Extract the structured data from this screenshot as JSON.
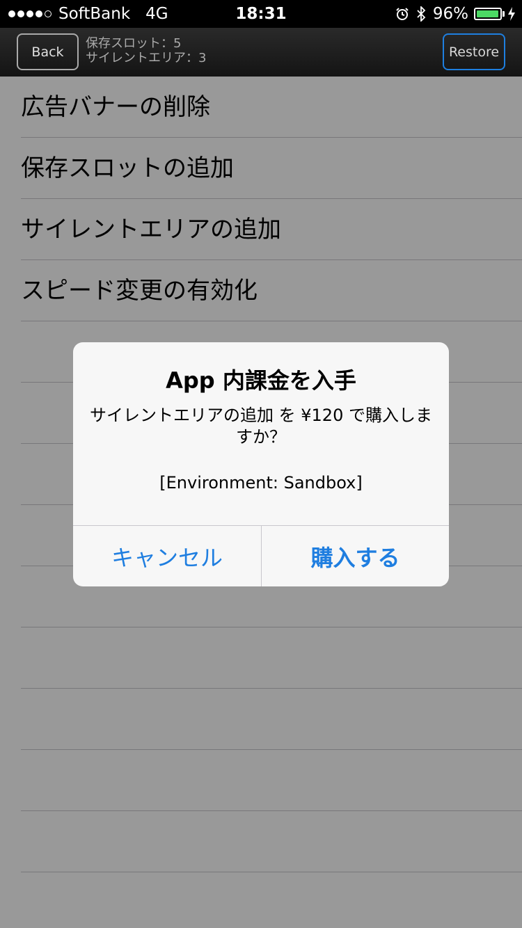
{
  "status_bar": {
    "carrier": "SoftBank",
    "network": "4G",
    "time": "18:31",
    "battery_percent": "96%",
    "battery_level": 0.96,
    "signal_bars_filled": 4,
    "signal_bars_total": 5,
    "icons": [
      "alarm-icon",
      "bluetooth-icon",
      "battery-icon",
      "charging-icon"
    ]
  },
  "nav": {
    "back_label": "Back",
    "restore_label": "Restore",
    "save_slots": "保存スロット：5",
    "silent_areas": "サイレントエリア：3"
  },
  "list": {
    "items": [
      {
        "label": "広告バナーの削除"
      },
      {
        "label": "保存スロットの追加"
      },
      {
        "label": "サイレントエリアの追加"
      },
      {
        "label": "スピード変更の有効化"
      },
      {
        "label": ""
      },
      {
        "label": ""
      },
      {
        "label": ""
      },
      {
        "label": ""
      },
      {
        "label": ""
      },
      {
        "label": ""
      },
      {
        "label": ""
      },
      {
        "label": ""
      },
      {
        "label": ""
      },
      {
        "label": ""
      }
    ]
  },
  "alert": {
    "title": "App 内課金を入手",
    "message": "サイレントエリアの追加 を ¥120 で購入しますか？",
    "environment": "[Environment: Sandbox]",
    "cancel_label": "キャンセル",
    "buy_label": "購入する"
  },
  "colors": {
    "accent_blue": "#1f7ee0",
    "battery_green": "#4cd964",
    "nav_background": "#1c1c1c",
    "overlay": "rgba(0,0,0,0.40)"
  }
}
